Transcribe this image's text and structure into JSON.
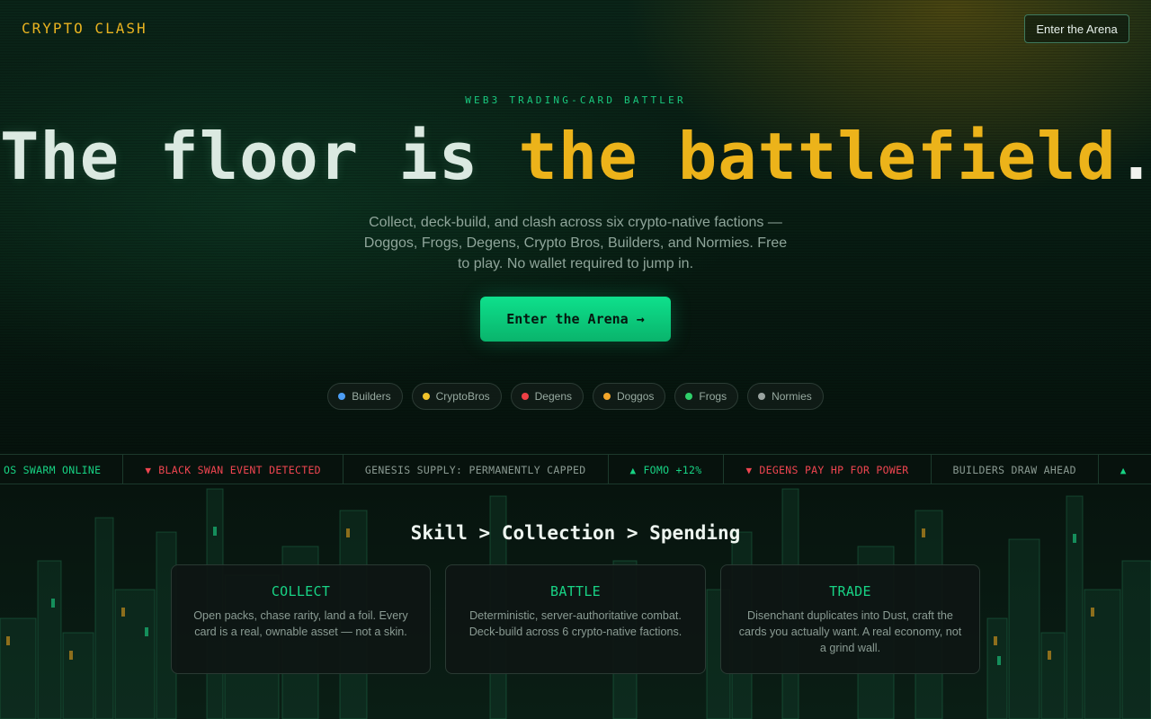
{
  "nav": {
    "brand": "CRYPTO CLASH",
    "cta_label": "Enter the Arena"
  },
  "hero": {
    "eyebrow": "WEB3 TRADING-CARD BATTLER",
    "headline_prefix": "The floor is ",
    "headline_highlight": "the battlefield",
    "headline_period": ".",
    "subtitle": "Collect, deck-build, and clash across six crypto-native factions — Doggos, Frogs, Degens, Crypto Bros, Builders, and Normies. Free to play. No wallet required to jump in.",
    "cta_label": "Enter the Arena →",
    "factions": [
      {
        "label": "Builders",
        "color": "#4d9ef6"
      },
      {
        "label": "CryptoBros",
        "color": "#f0c22a"
      },
      {
        "label": "Degens",
        "color": "#ee4046"
      },
      {
        "label": "Doggos",
        "color": "#f2a62a"
      },
      {
        "label": "Frogs",
        "color": "#2fcf6a"
      },
      {
        "label": "Normies",
        "color": "#9aa3a0"
      }
    ]
  },
  "ticker": [
    {
      "text": "OS SWARM ONLINE",
      "trend": "up",
      "arrow": ""
    },
    {
      "text": "BLACK SWAN EVENT DETECTED",
      "trend": "down",
      "arrow": "▼"
    },
    {
      "text": "GENESIS SUPPLY: PERMANENTLY CAPPED",
      "trend": "neutral",
      "arrow": ""
    },
    {
      "text": "FOMO +12%",
      "trend": "up",
      "arrow": "▲"
    },
    {
      "text": "DEGENS PAY HP FOR POWER",
      "trend": "down",
      "arrow": "▼"
    },
    {
      "text": "BUILDERS DRAW AHEAD",
      "trend": "neutral",
      "arrow": ""
    },
    {
      "text": "",
      "trend": "up",
      "arrow": "▲"
    }
  ],
  "features": {
    "title": "Skill > Collection > Spending",
    "cards": [
      {
        "title": "COLLECT",
        "body": "Open packs, chase rarity, land a foil. Every card is a real, ownable asset — not a skin."
      },
      {
        "title": "BATTLE",
        "body": "Deterministic, server-authoritative combat. Deck-build across 6 crypto-native factions."
      },
      {
        "title": "TRADE",
        "body": "Disenchant duplicates into Dust, craft the cards you actually want. A real economy, not a grind wall."
      }
    ]
  },
  "colors": {
    "accent_green": "#10d98a",
    "accent_gold": "#ecb31a",
    "down_red": "#ef4550"
  }
}
